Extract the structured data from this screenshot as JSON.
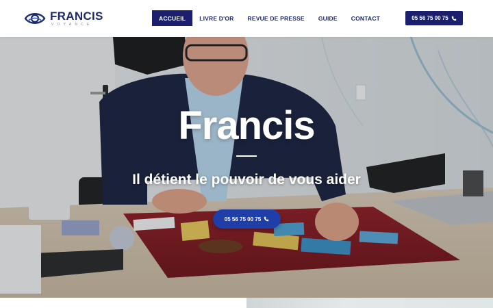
{
  "brand": {
    "name": "FRANCIS",
    "tagline": "VOYANCE"
  },
  "nav": {
    "items": [
      {
        "label": "ACCUEIL",
        "active": true
      },
      {
        "label": "LIVRE D'OR",
        "active": false
      },
      {
        "label": "REVUE DE PRESSE",
        "active": false
      },
      {
        "label": "GUIDE",
        "active": false
      },
      {
        "label": "CONTACT",
        "active": false
      }
    ]
  },
  "header": {
    "phone_label": "05 56 75 00 75",
    "phone_icon": "phone-icon"
  },
  "hero": {
    "title": "Francis",
    "subtitle": "Il détient le pouvoir de vous aider",
    "cta_label": "05 56 75 00 75",
    "cta_icon": "phone-icon"
  },
  "colors": {
    "brand_navy": "#1c1f6e",
    "cta_blue": "#1f3ea8",
    "text_navy": "#1c2a6b"
  }
}
